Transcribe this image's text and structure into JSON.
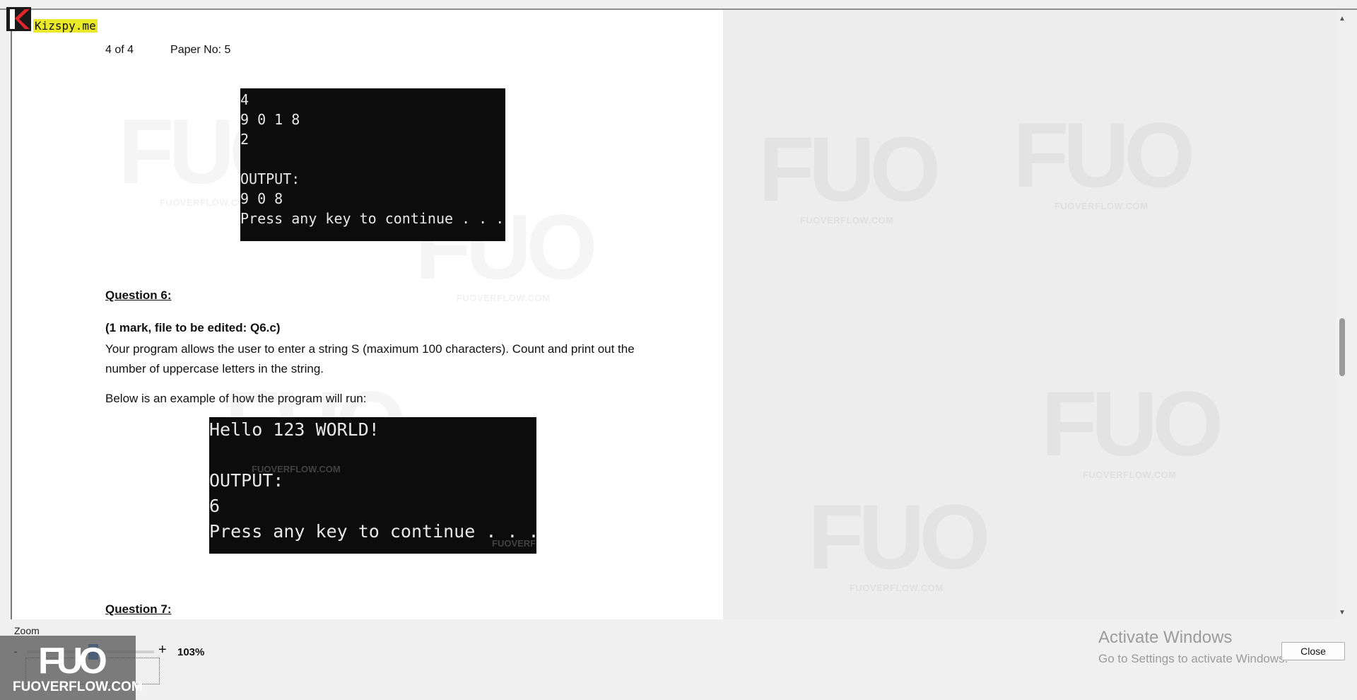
{
  "logo": {
    "site": "Kizspy.me"
  },
  "document": {
    "header": {
      "page_indicator": "4 of 4",
      "paper_no": "Paper No: 5"
    },
    "console1": {
      "lines": [
        "4",
        "9 0 1 8",
        "2",
        "",
        "OUTPUT:",
        "9 0 8",
        "Press any key to continue . . ."
      ]
    },
    "question6": {
      "title": "Question 6:",
      "marks": "(1 mark, file to be edited: Q6.c)",
      "description": "Your program allows the user to enter a string S (maximum 100 characters). Count and print out the number of uppercase letters in the string.",
      "example_intro": "Below is an example of how the program will run:"
    },
    "console2": {
      "lines": [
        "Hello 123 WORLD!",
        "",
        "OUTPUT:",
        "6",
        "Press any key to continue . . ."
      ]
    },
    "question7": {
      "title": "Question 7:"
    },
    "watermark": {
      "logo": "FUO",
      "site": "FUOVERFLOW.COM"
    }
  },
  "zoom": {
    "label": "Zoom",
    "minus": "-",
    "plus": "+",
    "value": "103%"
  },
  "badge": {
    "logo": "FUO",
    "site": "FUOVERFLOW.COM"
  },
  "activation": {
    "title": "Activate Windows",
    "subtitle": "Go to Settings to activate Windows."
  },
  "close_button": {
    "label": "Close"
  },
  "scrollbar": {
    "up_arrow": "▲",
    "down_arrow": "▼"
  }
}
